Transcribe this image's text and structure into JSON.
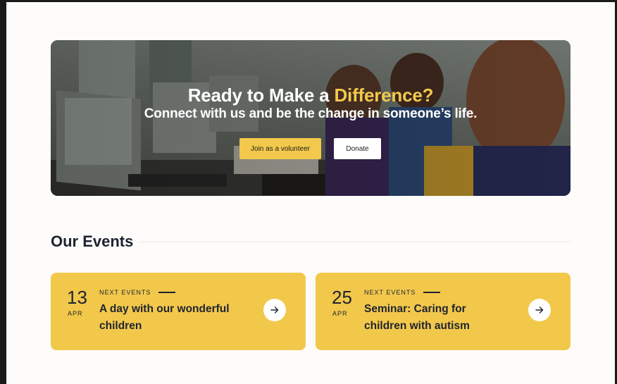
{
  "hero": {
    "title_prefix": "Ready to Make a ",
    "title_accent": "Difference?",
    "subtitle": "Connect with us and be the change in someone’s life.",
    "volunteer_label": "Join as a volunteer",
    "donate_label": "Donate",
    "accent_color": "#f2c94c"
  },
  "events": {
    "heading": "Our Events",
    "items": [
      {
        "day": "13",
        "month": "APR",
        "tag": "NEXT EVENTS",
        "title": "A day with our wonderful children",
        "icon": "arrow-right-icon"
      },
      {
        "day": "25",
        "month": "APR",
        "tag": "NEXT EVENTS",
        "title": "Seminar: Caring for children with autism",
        "icon": "arrow-right-icon"
      }
    ],
    "card_color": "#f2c84b"
  }
}
